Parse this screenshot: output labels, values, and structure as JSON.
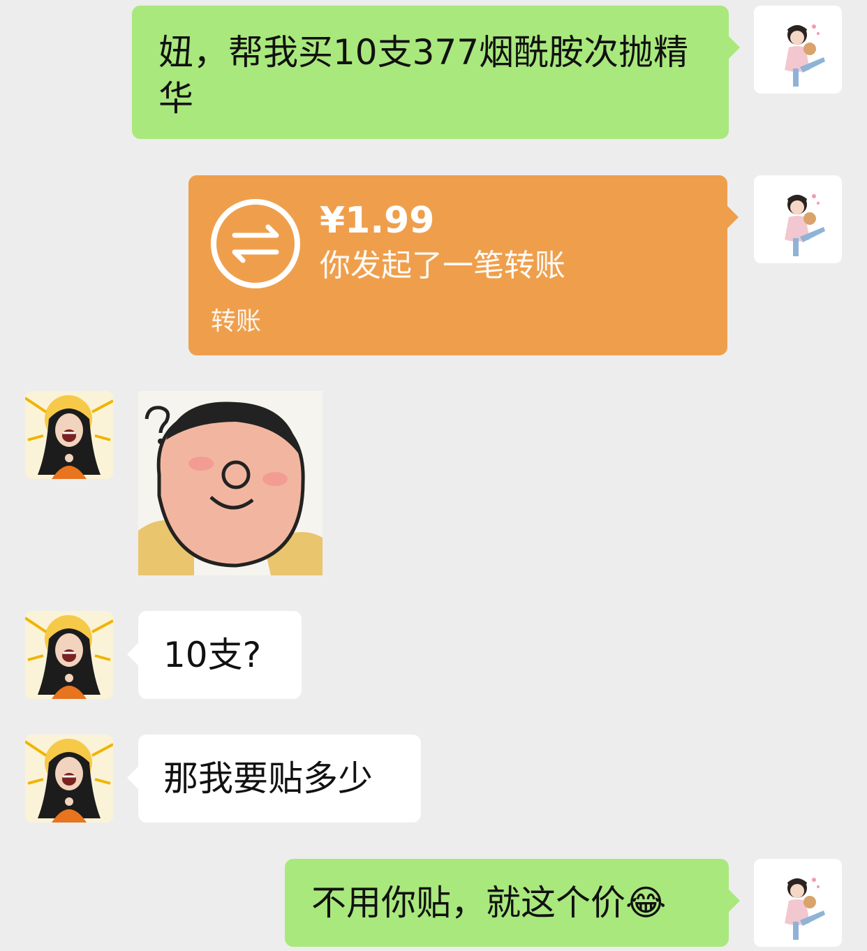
{
  "messages": {
    "m1": {
      "text": "妞，帮我买10支377烟酰胺次抛精华"
    },
    "m2": {
      "amount": "¥1.99",
      "description": "你发起了一笔转账",
      "label": "转账"
    },
    "m4": {
      "text": "10支?"
    },
    "m5": {
      "text": "那我要贴多少"
    },
    "m6": {
      "text": "不用你贴，就这个价😂"
    }
  },
  "colors": {
    "background": "#ededed",
    "sent_bubble": "#a9e87d",
    "received_bubble": "#ffffff",
    "transfer": "#ef9f4c"
  },
  "icons": {
    "transfer": "transfer-arrows-icon",
    "sticker": "confused-face-sticker"
  }
}
